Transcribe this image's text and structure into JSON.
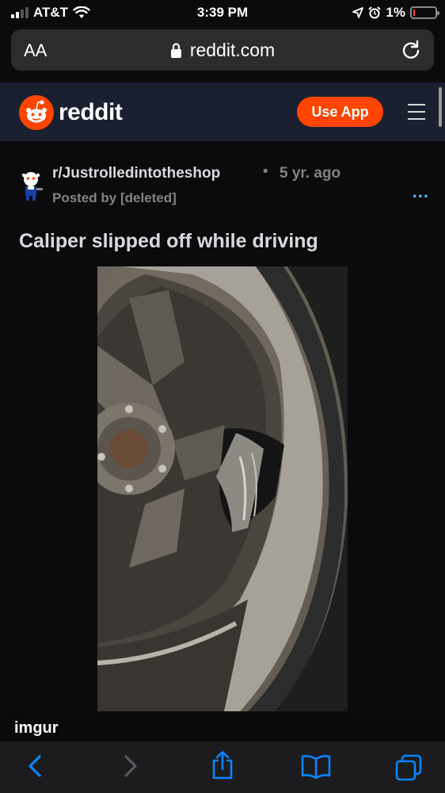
{
  "status_bar": {
    "carrier": "AT&T",
    "time": "3:39 PM",
    "battery": "1%"
  },
  "browser": {
    "text_size_label": "AA",
    "url": "reddit.com"
  },
  "reddit_header": {
    "wordmark": "reddit",
    "use_app_label": "Use App"
  },
  "post": {
    "subreddit": "r/Justrolledintotheshop",
    "separator": "•",
    "age": "5 yr. ago",
    "posted_by": "Posted by [deleted]",
    "more": "...",
    "title": "Caliper slipped off while driving",
    "image_source": "imgur"
  },
  "colors": {
    "accent": "#ff4500",
    "link": "#4fbcff",
    "header_bg": "#1a2030",
    "page_bg": "#0b0b0d"
  },
  "icons": [
    "wifi-icon",
    "location-icon",
    "alarm-icon",
    "battery-icon",
    "lock-icon",
    "reload-icon",
    "reddit-logo-icon",
    "hamburger-icon",
    "snoo-avatar-icon",
    "back-icon",
    "forward-icon",
    "share-icon",
    "bookmarks-icon",
    "tabs-icon"
  ]
}
